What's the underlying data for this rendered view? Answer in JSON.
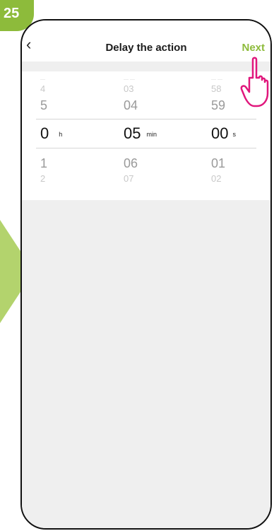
{
  "step": "25",
  "nav": {
    "title": "Delay the action",
    "next_label": "Next"
  },
  "picker": {
    "hours": {
      "far_top": "4",
      "top": "5",
      "selected": "0",
      "unit": "h",
      "bottom": "1",
      "far_bottom": "2"
    },
    "minutes": {
      "far_top": "03",
      "top": "04",
      "selected": "05",
      "unit": "min",
      "bottom": "06",
      "far_bottom": "07"
    },
    "seconds": {
      "far_top": "58",
      "top": "59",
      "selected": "00",
      "unit": "s",
      "bottom": "01",
      "far_bottom": "02"
    }
  },
  "colors": {
    "accent": "#8dbb3b",
    "highlight": "#e0177c",
    "arrow": "#b3d36d"
  }
}
